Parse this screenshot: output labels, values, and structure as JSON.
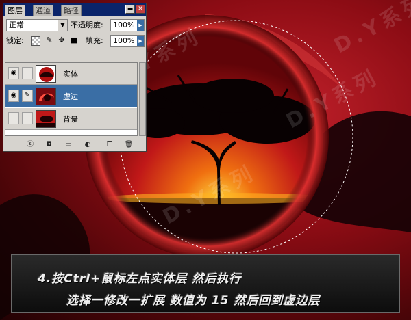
{
  "layers_panel": {
    "tabs": [
      {
        "label": "图层"
      },
      {
        "label": "通道"
      },
      {
        "label": "路径"
      }
    ],
    "blend_mode": "正常",
    "opacity_label": "不透明度:",
    "opacity_value": "100%",
    "lock_label": "锁定:",
    "fill_label": "填充:",
    "fill_value": "100%",
    "layers": [
      {
        "name": "实体",
        "visible": true,
        "selected": false
      },
      {
        "name": "虚边",
        "visible": true,
        "selected": true
      },
      {
        "name": "背景",
        "visible": false,
        "selected": false
      }
    ],
    "icons": {
      "visibility": "eye-icon",
      "brush": "brush-icon",
      "lock_transparency": "checker-icon",
      "lock_paint": "brush-icon",
      "lock_move": "move-icon",
      "lock_all": "lock-icon",
      "footer": [
        "link-layers-icon",
        "layer-mask-icon",
        "new-folder-icon",
        "adjustment-icon",
        "new-layer-icon",
        "trash-icon"
      ]
    }
  },
  "caption": {
    "line1": "4.按Ctrl+鼠标左点实体层 然后执行",
    "line2": "选择一修改一扩展 数值为 15  然后回到虚边层"
  },
  "watermark": "D.Y系列",
  "colors": {
    "selection_blue": "#3a6ea5",
    "panel_gray": "#d6d3ce",
    "sky_red": "#c0202a",
    "sun_yellow": "#f0d020"
  }
}
